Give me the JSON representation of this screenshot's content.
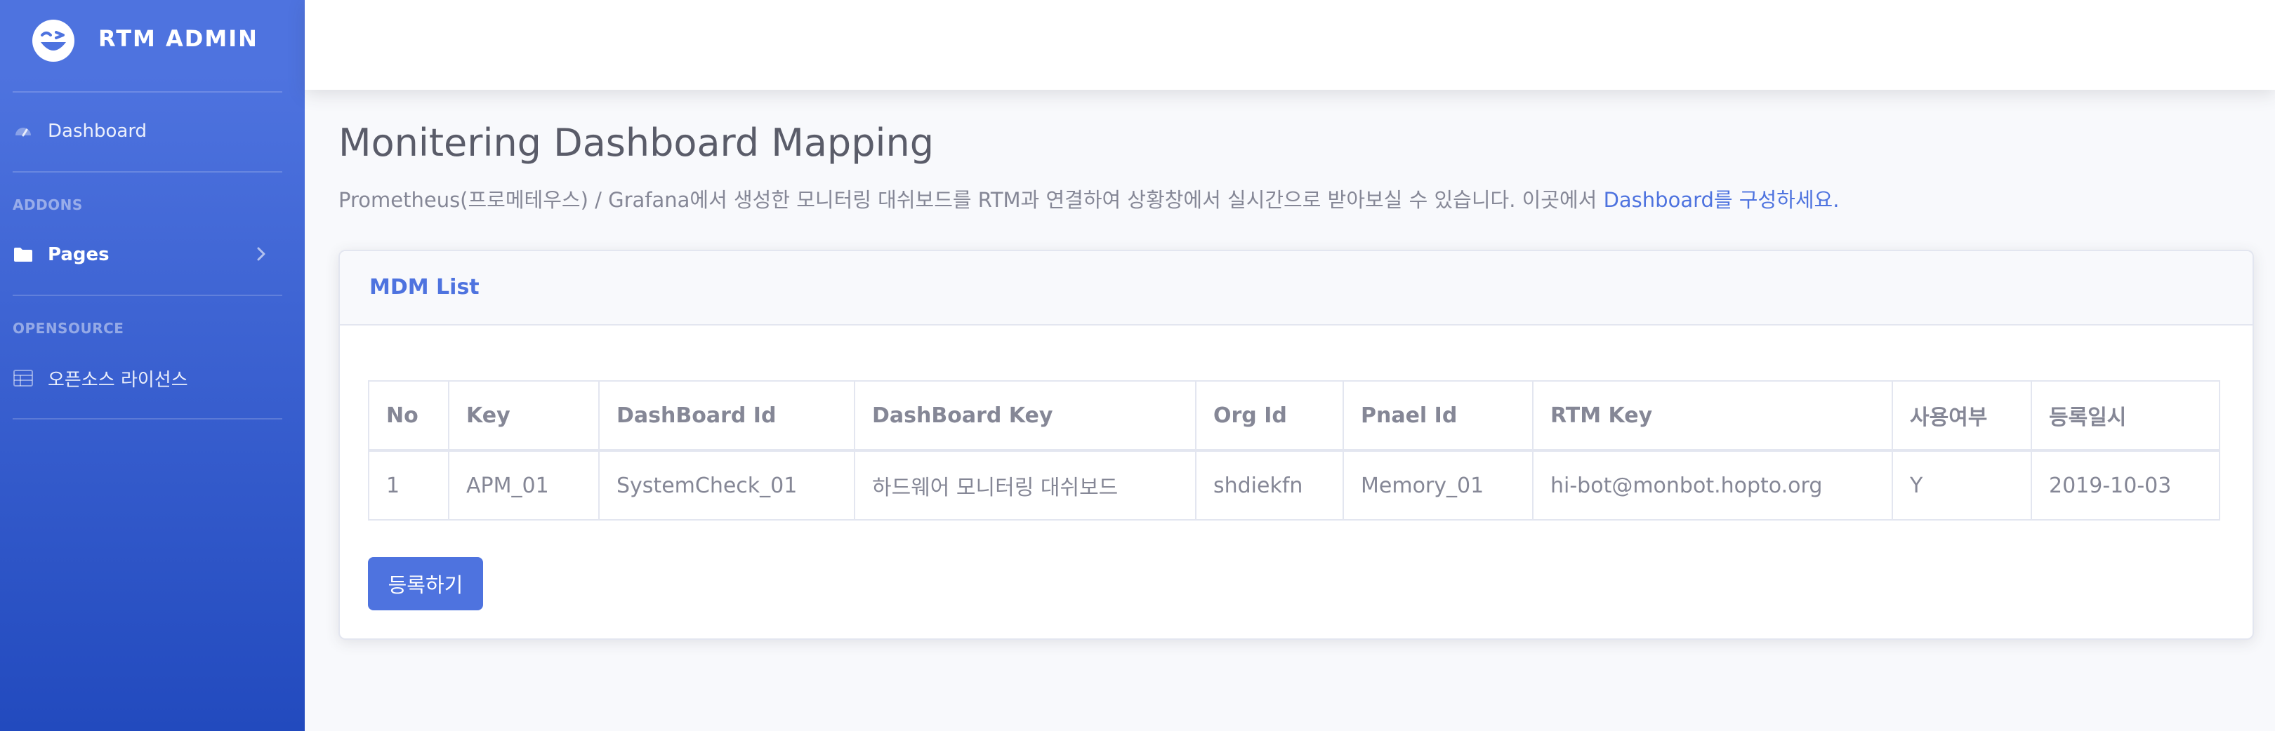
{
  "brand": {
    "title": "RTM ADMIN",
    "logo_icon": "laughing-wink-face-icon"
  },
  "sidebar": {
    "dashboard": {
      "label": "Dashboard",
      "icon": "tachometer-icon"
    },
    "addons_heading": "ADDONS",
    "pages": {
      "label": "Pages",
      "icon": "folder-icon"
    },
    "opensource_heading": "OPENSOURCE",
    "license": {
      "label": "오픈소스 라이선스",
      "icon": "table-icon"
    }
  },
  "main": {
    "title": "Monitering Dashboard Mapping",
    "description": "Prometheus(프로메테우스) / Grafana에서 생성한 모니터링 대쉬보드를 RTM과 연결하여 상황창에서 실시간으로 받아보실 수 있습니다. 이곳에서 ",
    "description_link": "Dashboard를 구성하세요."
  },
  "card": {
    "title": "MDM List",
    "columns": [
      "No",
      "Key",
      "DashBoard Id",
      "DashBoard Key",
      "Org Id",
      "Pnael Id",
      "RTM Key",
      "사용여부",
      "등록일시"
    ],
    "rows": [
      [
        "1",
        "APM_01",
        "SystemCheck_01",
        "하드웨어 모니터링 대쉬보드",
        "shdiekfn",
        "Memory_01",
        "hi-bot@monbot.hopto.org",
        "Y",
        "2019-10-03"
      ]
    ],
    "register_button": "등록하기"
  },
  "colors": {
    "primary": "#4e73df",
    "sidebar_dark": "#224abe",
    "text": "#858796",
    "heading": "#5a5c69"
  }
}
